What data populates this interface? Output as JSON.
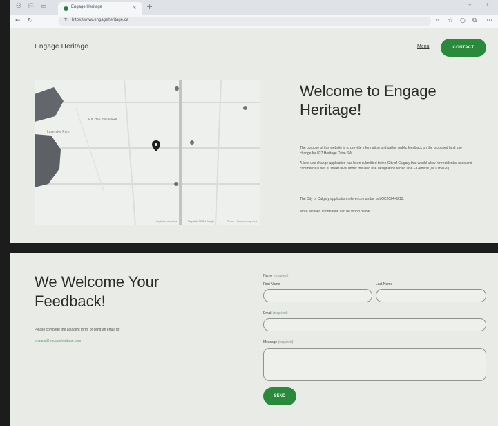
{
  "browser": {
    "tab_title": "Engage Heritage",
    "url": "https://www.engageheritage.ca"
  },
  "site": {
    "logo": "Engage Heritage",
    "menu_label": "Menu",
    "contact_label": "CONTACT"
  },
  "map": {
    "labels": [
      "Lavender Park",
      "RICHMOND PARK"
    ],
    "footer": [
      "Keyboard shortcuts",
      "Map data ©2024 Google",
      "Terms",
      "Report a map error"
    ]
  },
  "hero": {
    "title": "Welcome to Engage Heritage!",
    "paragraphs": [
      "The purpose of this website is to provide information and gather public feedback on the proposed land use change for 827 Heritage Drive SW.",
      "A land use change application has been submitted to the City of Calgary that would allow for residential uses and commercial uses at street level under the land use designation Mixed Use – General (MU-1f5h20).",
      "The City of Calgary application reference number is LOC2024-0213.",
      "More detailed information can be found below."
    ]
  },
  "feedback": {
    "title": "We Welcome Your Feedback!",
    "description": "Please complete the adjacent form, or send an email to:",
    "email": "engage@engageheritage.com",
    "form": {
      "name_label": "Name",
      "required_tag": "(required)",
      "first_name_label": "First Name",
      "last_name_label": "Last Name",
      "email_label": "Email",
      "message_label": "Message",
      "send_label": "SEND"
    }
  },
  "colors": {
    "accent": "#2a8a3c",
    "page_bg": "#e9ebe6"
  }
}
